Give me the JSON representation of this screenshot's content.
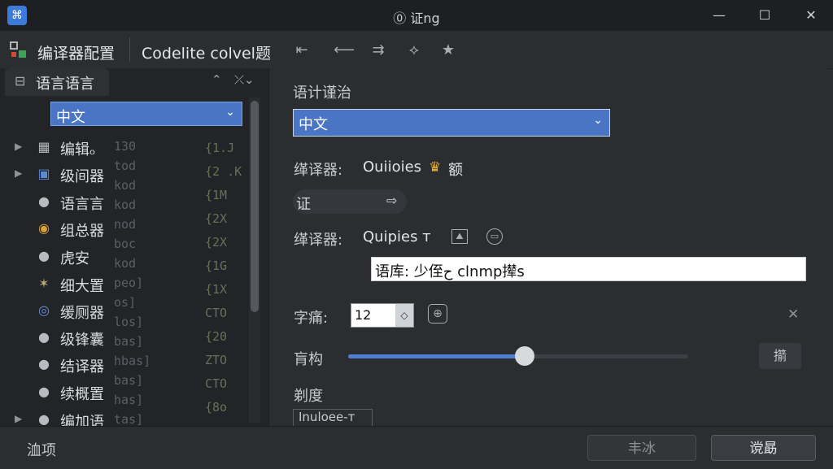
{
  "window": {
    "title": "⓪ 证ng",
    "minimize": "—",
    "maximize": "☐",
    "close": "✕"
  },
  "toolbar": {
    "compiler_config": "编译器配置",
    "project_title": "Codelite colvel题"
  },
  "left_panel": {
    "tab_label": "语言语言",
    "tab_controls": [
      "⌃",
      "⤫⌄"
    ],
    "select_value": "中文",
    "tree_items": [
      {
        "label": "编辑ₒ",
        "expandable": true
      },
      {
        "label": "级间器",
        "expandable": true
      },
      {
        "label": "语言言",
        "expandable": false
      },
      {
        "label": "组总器",
        "expandable": false
      },
      {
        "label": "虎安",
        "expandable": false
      },
      {
        "label": "细大置",
        "expandable": false
      },
      {
        "label": "缓厕器",
        "expandable": false
      },
      {
        "label": "级锋囊",
        "expandable": false
      },
      {
        "label": "结译器",
        "expandable": false
      },
      {
        "label": "续概置",
        "expandable": false
      },
      {
        "label": "编加语",
        "expandable": true
      }
    ],
    "ghost_code_a": [
      "130",
      "tod",
      "kod",
      "kod",
      "nod",
      "boc",
      "kod",
      "peo]",
      "os]",
      "los]",
      "bas]",
      "hbas]",
      "bas]",
      "has]",
      "tas]"
    ],
    "ghost_code_b": [
      "{1.J",
      "{2 .K",
      "{1M",
      "{2X",
      "{2X",
      "{1G",
      "{1X",
      "CTO",
      "{20",
      "ZTO",
      "CTO",
      "{8o"
    ]
  },
  "settings": {
    "language_heading": "语计谨治",
    "language_value": "中文",
    "compiler_label_1": "缂译器:",
    "compiler_value_1": "Ouiioies",
    "compiler_badge": "额",
    "pill_label": "证",
    "compiler_label_2": "缂译器:",
    "compiler_value_2": "Quipies т",
    "text_input_value": "语库: 少侄ح clnmp撵s",
    "font_size_label": "字痛:",
    "font_size_value": "12",
    "slider_label": "肓构",
    "slider_value_fraction": 0.52,
    "slider_button": "擶",
    "precision_label": "剃度",
    "partial_box_text": "Inuloee-т"
  },
  "footer": {
    "options_label": "洫项",
    "secondary_button": "丰冰",
    "primary_button": "谠勗"
  },
  "colors": {
    "accent": "#4a74c4",
    "panel_bg": "#232427",
    "window_bg": "#2b2d31"
  }
}
